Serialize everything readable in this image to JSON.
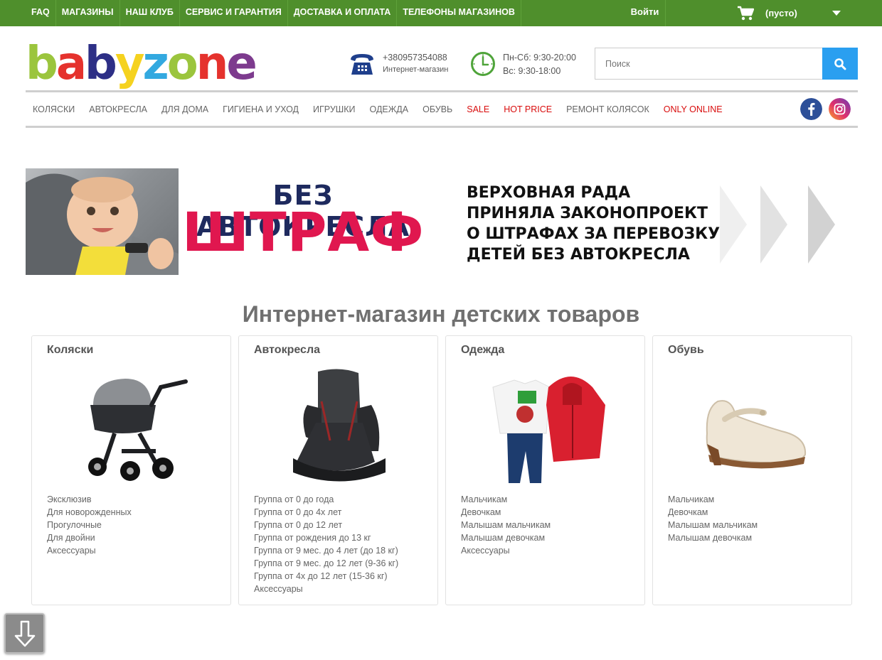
{
  "topbar": {
    "links": [
      "FAQ",
      "МАГАЗИНЫ",
      "НАШ КЛУБ",
      "СЕРВИС И ГАРАНТИЯ",
      "ДОСТАВКА И ОПЛАТА",
      "ТЕЛЕФОНЫ МАГАЗИНОВ"
    ],
    "login": "Войти",
    "cart": "(пусто)",
    "bg_color": "#4f8f2c"
  },
  "header": {
    "logo_letters": [
      "b",
      "a",
      "b",
      "y",
      "z",
      "o",
      "n",
      "e"
    ],
    "logo_colors": [
      "#9bc53d",
      "#e5322d",
      "#2d2f86",
      "#f5d21f",
      "#33a9e0",
      "#9bc53d",
      "#e5322d",
      "#7d3b8e"
    ],
    "phone": "+380957354088",
    "phone_label": "Интернет-магазин",
    "hours_weekday": "Пн-Сб: 9:30-20:00",
    "hours_sunday": "Вс: 9:30-18:00",
    "search_placeholder": "Поиск"
  },
  "mainnav": {
    "items": [
      "КОЛЯСКИ",
      "АВТОКРЕСЛА",
      "ДЛЯ ДОМА",
      "ГИГИЕНА И УХОД",
      "ИГРУШКИ",
      "ОДЕЖДА",
      "ОБУВЬ",
      "SALE",
      "HOT PRICE",
      "РЕМОНТ КОЛЯСОК",
      "ONLY ONLINE"
    ],
    "highlight_color": "#d90d0d",
    "social": [
      "facebook-icon",
      "instagram-icon"
    ]
  },
  "banner": {
    "title1": "БЕЗ АВТОКРЕСЛА",
    "title2": "ШТРАФ",
    "text": "ВЕРХОВНАЯ РАДА\nПРИНЯЛА ЗАКОНОПРОЕКТ\nО ШТРАФАХ ЗА ПЕРЕВОЗКУ\nДЕТЕЙ БЕЗ АВТОКРЕСЛА"
  },
  "page_title": "Интернет-магазин детских товаров",
  "categories": [
    {
      "title": "Коляски",
      "image": "stroller",
      "items": [
        "Эксклюзив",
        "Для новорожденных",
        "Прогулочные",
        "Для двойни",
        "Аксессуары"
      ]
    },
    {
      "title": "Автокресла",
      "image": "car-seat",
      "items": [
        "Группа от 0 до года",
        "Группа от 0 до 4х лет",
        "Группа от 0 до 12 лет",
        "Группа от рождения до 13 кг",
        "Группа от 9 мес. до 4 лет (до 18 кг)",
        "Группа от 9 мес. до 12 лет (9-36 кг)",
        "Группа от 4х до 12 лет (15-36 кг)",
        "Аксессуары"
      ]
    },
    {
      "title": "Одежда",
      "image": "clothes",
      "items": [
        "Мальчикам",
        "Девочкам",
        "Малышам мальчикам",
        "Малышам девочкам",
        "Аксессуары"
      ]
    },
    {
      "title": "Обувь",
      "image": "shoe",
      "items": [
        "Мальчикам",
        "Девочкам",
        "Малышам мальчикам",
        "Малышам девочкам"
      ]
    }
  ]
}
